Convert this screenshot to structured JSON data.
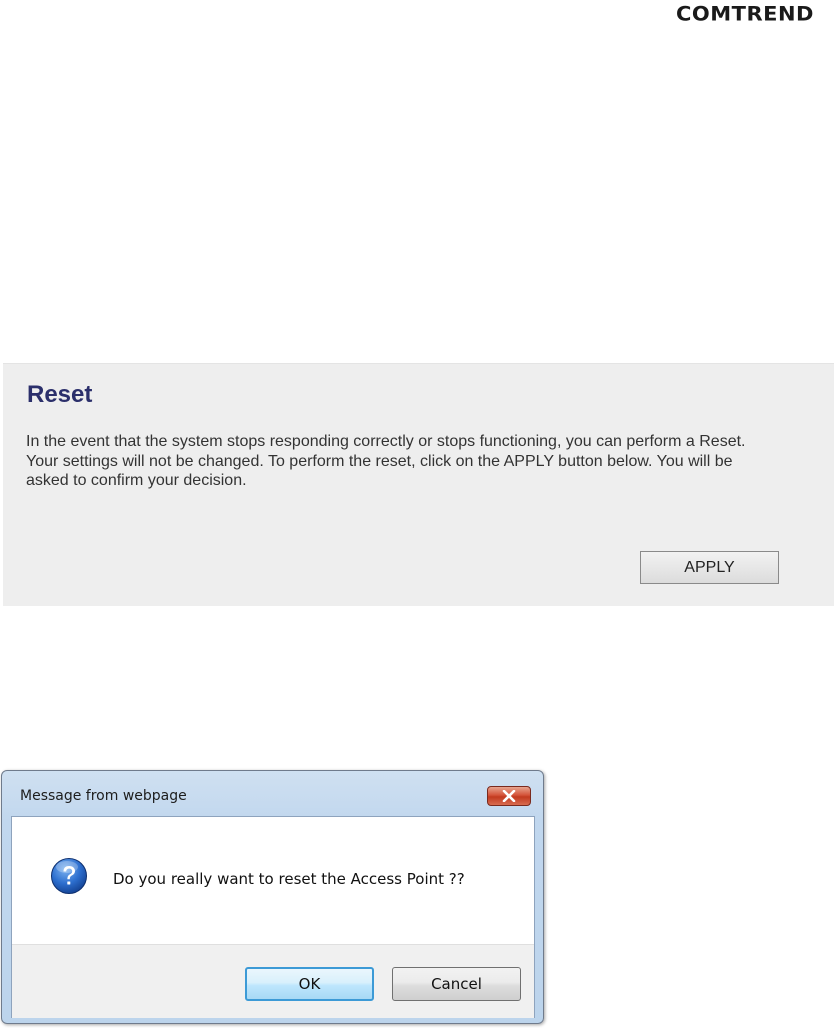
{
  "brand": {
    "logo_text": "COMTREND"
  },
  "reset": {
    "title": "Reset",
    "description": "In the event that the system stops responding correctly or stops functioning, you can perform a Reset. Your settings will not be changed. To perform the reset, click on the APPLY button below. You will be asked to confirm your decision.",
    "apply_label": "APPLY"
  },
  "dialog": {
    "title": "Message from webpage",
    "message": "Do you really want to reset the Access Point ??",
    "ok_label": "OK",
    "cancel_label": "Cancel",
    "icon": "question-icon",
    "close_icon": "close-icon"
  },
  "colors": {
    "title_color": "#2b2f6b",
    "panel_bg": "#eeeeee",
    "close_button": "#c23a1f",
    "question_icon": "#1f5fb8"
  }
}
